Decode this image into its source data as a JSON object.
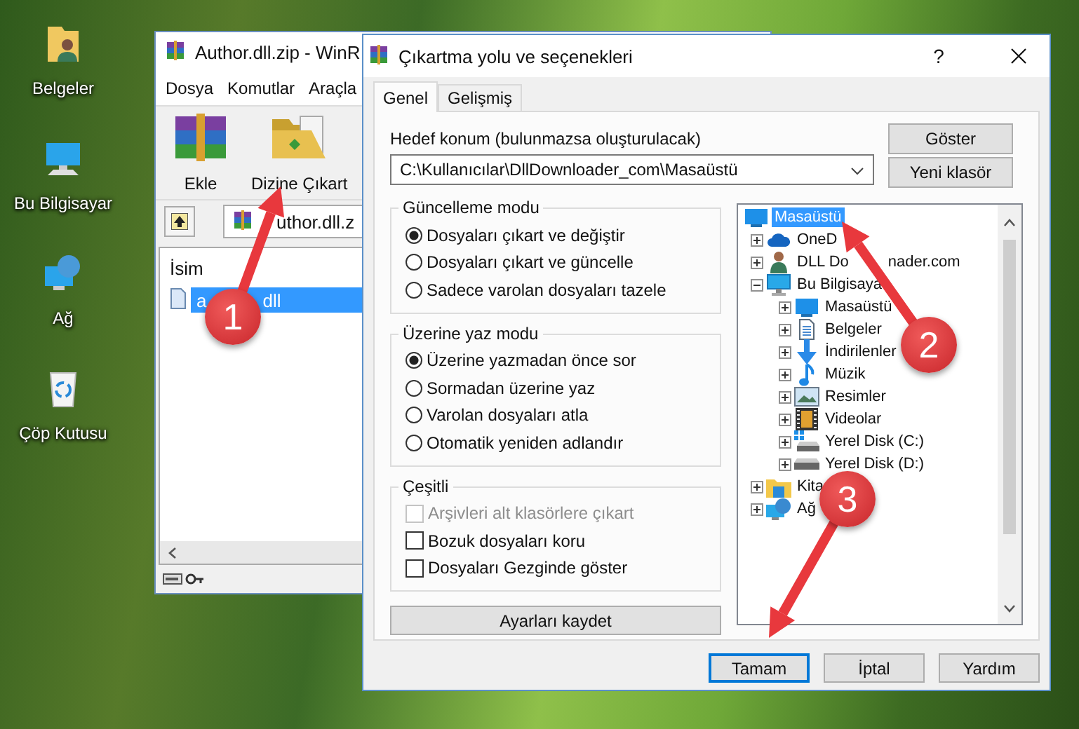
{
  "desktop": {
    "icons": [
      {
        "label": "Belgeler",
        "kind": "documents"
      },
      {
        "label": "Bu Bilgisayar",
        "kind": "computer"
      },
      {
        "label": "Ağ",
        "kind": "network"
      },
      {
        "label": "Çöp Kutusu",
        "kind": "recycle"
      }
    ]
  },
  "archiver": {
    "title": "Author.dll.zip - WinR",
    "menu": [
      "Dosya",
      "Komutlar",
      "Araçla"
    ],
    "toolbar": [
      {
        "label": "Ekle",
        "kind": "add"
      },
      {
        "label": "Dizine Çıkart",
        "kind": "extract"
      }
    ],
    "address": "uthor.dll.z",
    "column": "İsim",
    "files": [
      {
        "name": "a",
        "name_tail": "dll",
        "selected": true
      }
    ]
  },
  "dialog": {
    "title": "Çıkartma yolu ve seçenekleri",
    "help": "?",
    "tabs": [
      {
        "label": "Genel",
        "selected": true
      },
      {
        "label": "Gelişmiş",
        "selected": false
      }
    ],
    "destination": {
      "label": "Hedef konum (bulunmazsa oluşturulacak)",
      "value": "C:\\Kullanıcılar\\DllDownloader_com\\Masaüstü"
    },
    "side_buttons": [
      "Göster",
      "Yeni klasör"
    ],
    "groups": [
      {
        "title": "Güncelleme modu",
        "kind": "radio",
        "options": [
          {
            "label": "Dosyaları çıkart ve değiştir",
            "selected": true
          },
          {
            "label": "Dosyaları çıkart ve güncelle",
            "selected": false
          },
          {
            "label": "Sadece varolan dosyaları tazele",
            "selected": false
          }
        ]
      },
      {
        "title": "Üzerine yaz modu",
        "kind": "radio",
        "options": [
          {
            "label": "Üzerine yazmadan önce sor",
            "selected": true
          },
          {
            "label": "Sormadan üzerine yaz",
            "selected": false
          },
          {
            "label": "Varolan dosyaları atla",
            "selected": false
          },
          {
            "label": "Otomatik yeniden adlandır",
            "selected": false
          }
        ]
      },
      {
        "title": "Çeşitli",
        "kind": "checkbox",
        "options": [
          {
            "label": "Arşivleri alt klasörlere çıkart",
            "checked": false,
            "disabled": true
          },
          {
            "label": "Bozuk dosyaları koru",
            "checked": false,
            "disabled": false
          },
          {
            "label": "Dosyaları Gezginde göster",
            "checked": false,
            "disabled": false
          }
        ]
      }
    ],
    "save_button": "Ayarları kaydet",
    "folder_tree": {
      "root": {
        "label": "Masaüstü",
        "kind": "desktop",
        "selected": true
      },
      "children": [
        {
          "label": "OneD",
          "kind": "cloud",
          "expanded": false,
          "selected": false
        },
        {
          "label": "DLL Do",
          "label_tail": "nader.com",
          "kind": "person",
          "expanded": false,
          "selected": false
        },
        {
          "label": "Bu Bilgisaya",
          "kind": "computer",
          "expanded": true,
          "selected": false,
          "children": [
            {
              "label": "Masaüstü",
              "kind": "desktop",
              "expanded": false,
              "selected": false
            },
            {
              "label": "Belgeler",
              "kind": "document",
              "expanded": false,
              "selected": false
            },
            {
              "label": "İndirilenler",
              "kind": "download",
              "expanded": false,
              "selected": false
            },
            {
              "label": "Müzik",
              "kind": "music",
              "expanded": false,
              "selected": false
            },
            {
              "label": "Resimler",
              "kind": "picture",
              "expanded": false,
              "selected": false
            },
            {
              "label": "Videolar",
              "kind": "video",
              "expanded": false,
              "selected": false
            },
            {
              "label": "Yerel Disk (C:)",
              "kind": "system-drive",
              "expanded": false,
              "selected": false
            },
            {
              "label": "Yerel Disk (D:)",
              "kind": "drive",
              "expanded": false,
              "selected": false
            }
          ]
        },
        {
          "label": "Kita",
          "kind": "folder",
          "expanded": false,
          "selected": false
        },
        {
          "label": "Ağ",
          "kind": "network",
          "expanded": false,
          "selected": false
        }
      ]
    },
    "buttons": [
      {
        "label": "Tamam",
        "focused": true
      },
      {
        "label": "İptal",
        "focused": false
      },
      {
        "label": "Yardım",
        "focused": false
      }
    ]
  },
  "annotations": [
    {
      "label": "1"
    },
    {
      "label": "2"
    },
    {
      "label": "3"
    }
  ]
}
